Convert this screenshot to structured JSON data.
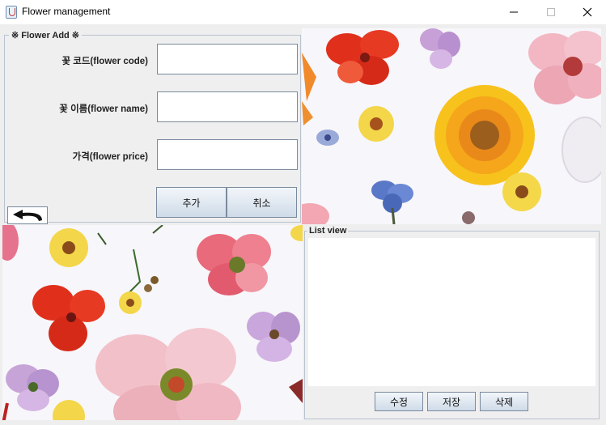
{
  "window": {
    "title": "Flower management"
  },
  "add_panel": {
    "legend": "※ Flower Add ※",
    "fields": [
      {
        "label": "꽃 코드(flower code)",
        "value": ""
      },
      {
        "label": "꽃 이름(flower name)",
        "value": ""
      },
      {
        "label": "가격(flower price)",
        "value": ""
      }
    ],
    "add_label": "추가",
    "cancel_label": "취소"
  },
  "list_panel": {
    "legend": "List view",
    "items": [],
    "edit_label": "수정",
    "save_label": "저장",
    "delete_label": "삭제"
  },
  "icons": {
    "app": "java-cup-icon",
    "back": "back-arrow-icon"
  },
  "colors": {
    "button_top": "#f2f6fa",
    "button_bottom": "#cfdbe8",
    "border": "#7a8a9e",
    "panel_bg": "#efefef"
  }
}
